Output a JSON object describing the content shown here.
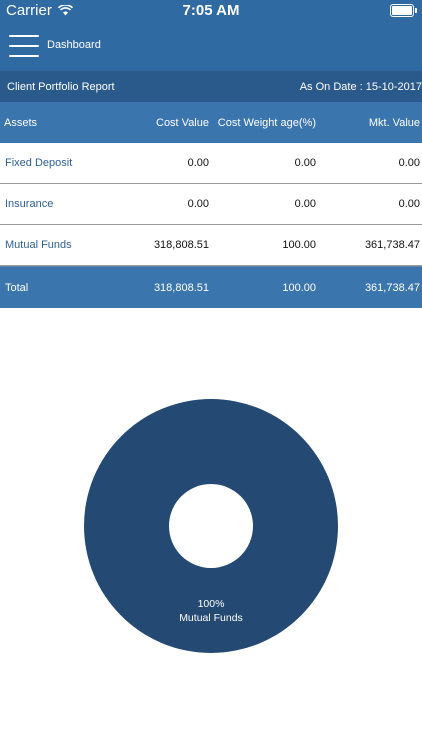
{
  "status": {
    "carrier": "Carrier",
    "time": "7:05 AM"
  },
  "nav": {
    "title": "Dashboard"
  },
  "report": {
    "title": "Client Portfolio Report",
    "date": "As On Date : 15-10-2017"
  },
  "table": {
    "headers": [
      "Assets",
      "Cost Value",
      "Cost Weight age(%)",
      "Mkt. Value"
    ],
    "rows": [
      {
        "asset": "Fixed Deposit",
        "cost": "0.00",
        "weight": "0.00",
        "mkt": "0.00"
      },
      {
        "asset": "Insurance",
        "cost": "0.00",
        "weight": "0.00",
        "mkt": "0.00"
      },
      {
        "asset": "Mutual Funds",
        "cost": "318,808.51",
        "weight": "100.00",
        "mkt": "361,738.47"
      }
    ],
    "total": {
      "label": "Total",
      "cost": "318,808.51",
      "weight": "100.00",
      "mkt": "361,738.47"
    }
  },
  "chart": {
    "percent_label": "100%",
    "category_label": "Mutual Funds"
  },
  "chart_data": {
    "type": "pie",
    "categories": [
      "Mutual Funds"
    ],
    "values": [
      100
    ],
    "colors": [
      "#244a74"
    ],
    "hole": true
  },
  "colors": {
    "header": "#2f6aa3",
    "subheader": "#2a5a8b",
    "table_header": "#3a75ad",
    "pie": "#244a74"
  }
}
